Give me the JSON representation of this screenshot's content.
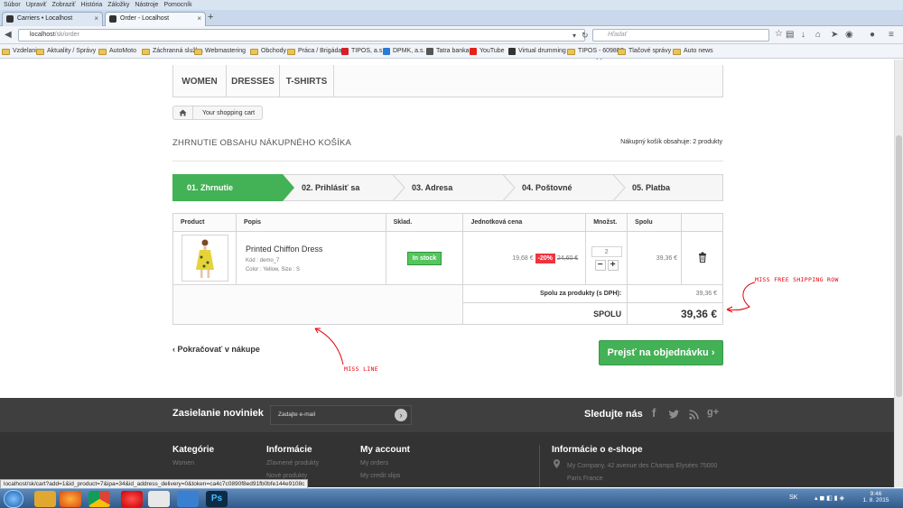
{
  "browser": {
    "menu": [
      "Súbor",
      "Upraviť",
      "Zobraziť",
      "História",
      "Záložky",
      "Nástroje",
      "Pomocník"
    ],
    "tabs": [
      {
        "title": "Carriers • Localhost",
        "active": false
      },
      {
        "title": "Order - Localhost",
        "active": true
      }
    ],
    "url_host": "localhost",
    "url_path": "/sk/order",
    "search_placeholder": "Hľadať",
    "bookmarks": [
      {
        "label": "Vzdelanie",
        "icon": "folder"
      },
      {
        "label": "Aktuality / Správy",
        "icon": "folder"
      },
      {
        "label": "AutoMoto",
        "icon": "folder"
      },
      {
        "label": "Záchranná služba",
        "icon": "folder"
      },
      {
        "label": "Webmastering",
        "icon": "folder"
      },
      {
        "label": "Obchody",
        "icon": "folder"
      },
      {
        "label": "Práca / Brigáda",
        "icon": "folder"
      },
      {
        "label": "TIPOS, a.s.",
        "icon": "site-icon",
        "color": "#d4202a"
      },
      {
        "label": "DPMK, a.s.",
        "icon": "site-icon",
        "color": "#2a7bd4"
      },
      {
        "label": "Tatra banka",
        "icon": "site-icon",
        "color": "#555555"
      },
      {
        "label": "YouTube",
        "icon": "youtube-icon",
        "color": "#e62117"
      },
      {
        "label": "Virtual drumming",
        "icon": "site-icon",
        "color": "#333333"
      },
      {
        "label": "TIPOS - 609807",
        "icon": "folder"
      },
      {
        "label": "Tlačové správy",
        "icon": "folder"
      },
      {
        "label": "Auto news",
        "icon": "folder"
      }
    ],
    "status_url": "localhost/sk/cart?add=1&id_product=7&ipa=34&id_address_delivery=0&token=ca4c7c0890f8ed91fb0bfe144e9108c"
  },
  "shop": {
    "top_menu": [
      "WOMEN",
      "DRESSES",
      "T-SHIRTS"
    ],
    "breadcrumb": "Your shopping cart",
    "heading": "ZHRNUTIE OBSAHU NÁKUPNÉHO KOŠÍKA",
    "cart_summary": "Nákupný košík obsahuje: 2 produkty",
    "steps": [
      "01. Zhrnutie",
      "02. Prihlásiť sa",
      "03. Adresa",
      "04. Poštovné",
      "05. Platba"
    ],
    "table": {
      "headers": [
        "Product",
        "Popis",
        "Sklad.",
        "Jednotková cena",
        "Množst.",
        "Spolu"
      ],
      "item": {
        "name": "Printed Chiffon Dress",
        "ref": "Kód : demo_7",
        "attrs": "Color : Yellow, Size : S",
        "stock": "In stock",
        "price": "19,68 €",
        "discount": "-20%",
        "old_price": "24,60 €",
        "qty": "2",
        "total": "39,36 €"
      },
      "subtotal_label": "Spolu za produkty (s DPH):",
      "subtotal": "39,36 €",
      "total_label": "SPOLU",
      "total": "39,36 €"
    },
    "continue_label": "Pokračovať v nákupe",
    "checkout_label": "Prejsť na objednávku",
    "annotations": {
      "shipping": "MISS FREE SHIPPING ROW",
      "line": "MISS LINE",
      "color": "#e8000a"
    },
    "newsletter": {
      "title": "Zasielanie noviniek",
      "placeholder": "Zadajte e-mail"
    },
    "follow": "Sledujte nás",
    "footer": {
      "categories": {
        "title": "Kategórie",
        "links": [
          "Women"
        ]
      },
      "info": {
        "title": "Informácie",
        "links": [
          "Zľavnené produkty",
          "Nové produkty"
        ]
      },
      "account": {
        "title": "My account",
        "links": [
          "My orders",
          "My credit slips"
        ]
      },
      "shop_info": {
        "title": "Informácie o e-shope",
        "address": "My Company, 42 avenue des Champs Elysées 75000 Paris France"
      }
    }
  },
  "taskbar": {
    "lang": "SK",
    "time": "9:46",
    "date": "1. 8. 2015"
  }
}
